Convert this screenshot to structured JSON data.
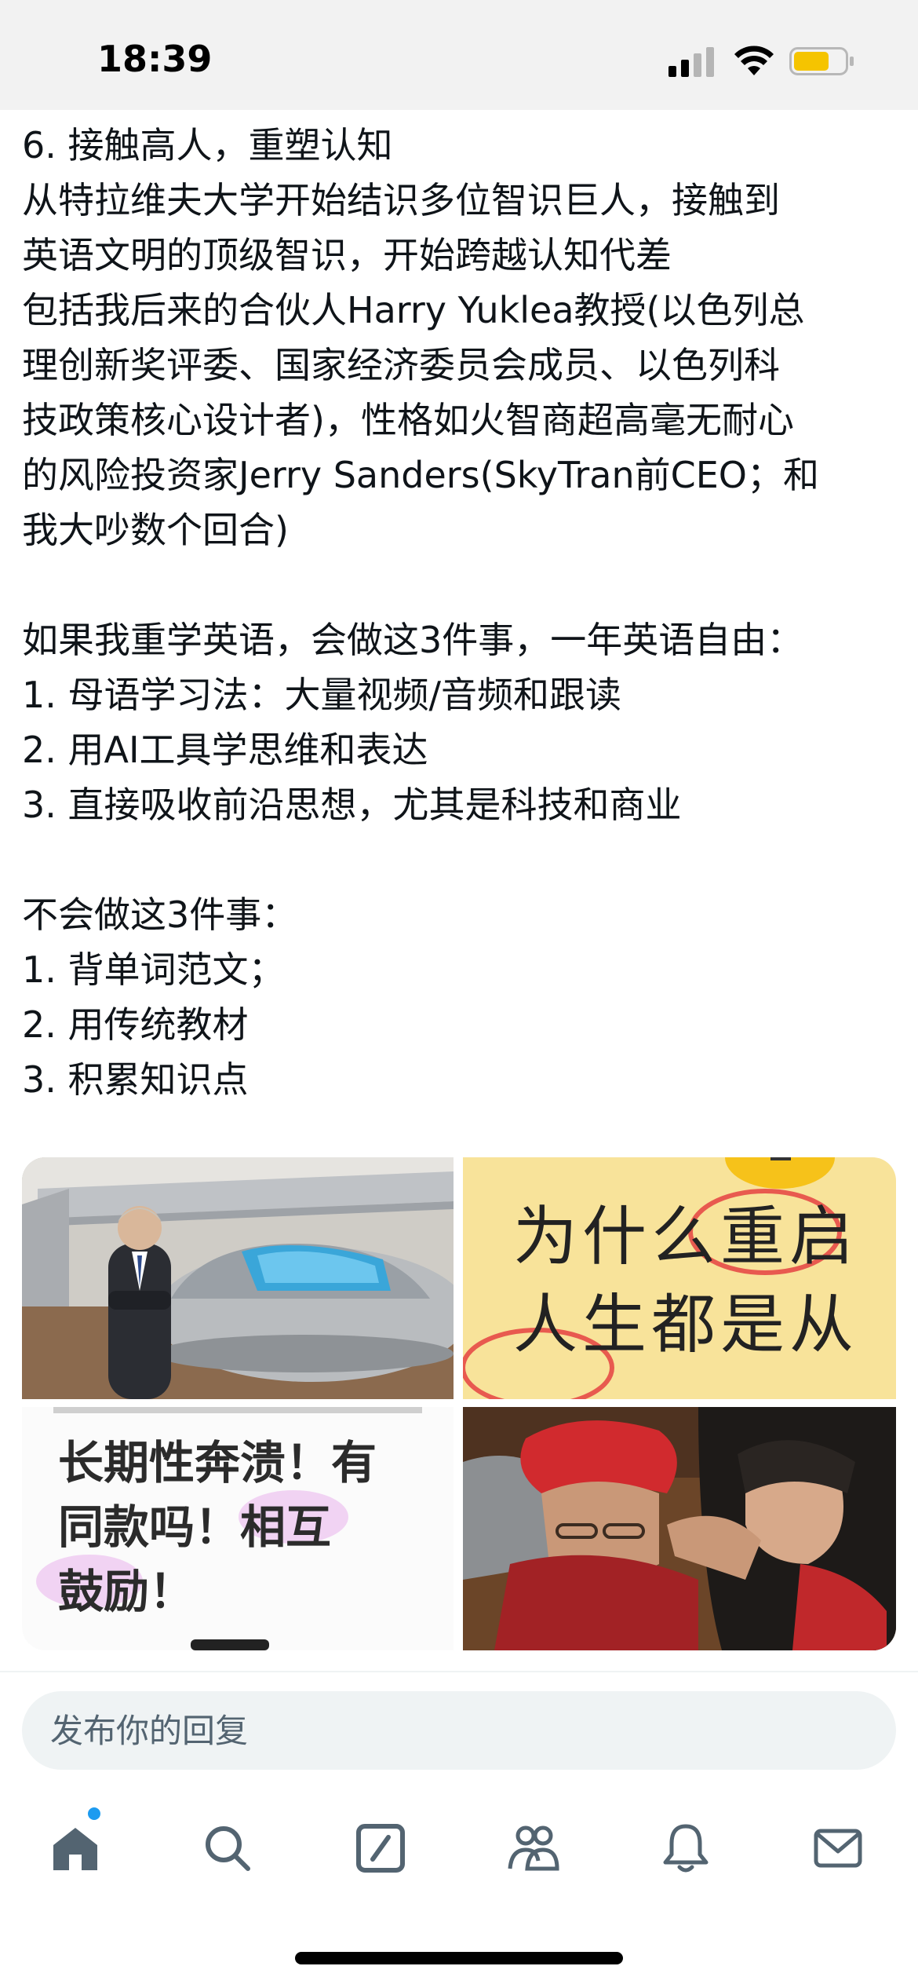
{
  "status_bar": {
    "time": "18:39"
  },
  "tweet": {
    "lines": [
      "6. 接触高人，重塑认知",
      "从特拉维夫大学开始结识多位智识巨人，接触到",
      "英语文明的顶级智识，开始跨越认知代差",
      "包括我后来的合伙人Harry Yuklea教授(以色列总",
      "理创新奖评委、国家经济委员会成员、以色列科",
      "技政策核心设计者)，性格如火智商超高毫无耐心",
      "的风险投资家Jerry Sanders(SkyTran前CEO；和",
      "我大吵数个回合)",
      "",
      "如果我重学英语，会做这3件事，一年英语自由：",
      "1. 母语学习法：大量视频/音频和跟读",
      "2. 用AI工具学思维和表达",
      "3. 直接吸收前沿思想，尤其是科技和商业",
      "",
      "不会做这3件事：",
      "1. 背单词范文；",
      "2. 用传统教材",
      "3. 积累知识点"
    ]
  },
  "media": {
    "card1_headline_1": "为什么重启",
    "card1_headline_2": "人生都是从",
    "card2_line_1": "长期性奔溃！有",
    "card2_line_2": "同款吗！相互",
    "card2_line_3": "鼓励！"
  },
  "reply": {
    "placeholder": "发布你的回复"
  },
  "tab_bar": {
    "icons": [
      "home-icon",
      "search-icon",
      "grok-icon",
      "communities-icon",
      "notifications-icon",
      "messages-icon"
    ],
    "active": "home-icon"
  },
  "colors": {
    "text": "#0f1419",
    "secondary": "#536471",
    "accent": "#1d9bf0",
    "reply_bg": "#eff3f4"
  }
}
